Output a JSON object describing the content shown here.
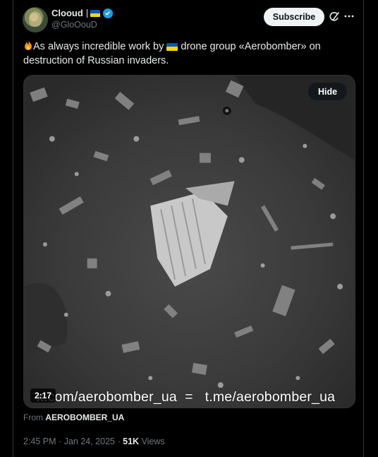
{
  "post": {
    "author_name": "Clooud",
    "author_handle": "@GloOouD",
    "subscribe_label": "Subscribe",
    "text_before_flag": "As always incredible work by ",
    "text_after_flag": " drone group «Aerobomber» on destruction of Russian invaders.",
    "media": {
      "hide_label": "Hide",
      "duration": "2:17",
      "watermark_left": "x.com/aerobomber_ua",
      "watermark_sep": "=",
      "watermark_right": "t.me/aerobomber_ua"
    },
    "from_prefix": "From",
    "from_source": "AEROBOMBER_UA",
    "time": "2:45 PM",
    "date": "Jan 24, 2025",
    "dot": "·",
    "views_count": "51K",
    "views_label": "Views"
  },
  "colors": {
    "background": "#000000",
    "text_primary": "#e7e9ea",
    "text_secondary": "#71767b",
    "verified_blue": "#1d9bf0",
    "flag_blue": "#0057b7",
    "flag_yellow": "#ffd700"
  },
  "icons": [
    "ukraine-flag-icon",
    "verified-badge-icon",
    "grok-icon",
    "more-icon",
    "fire-icon"
  ]
}
